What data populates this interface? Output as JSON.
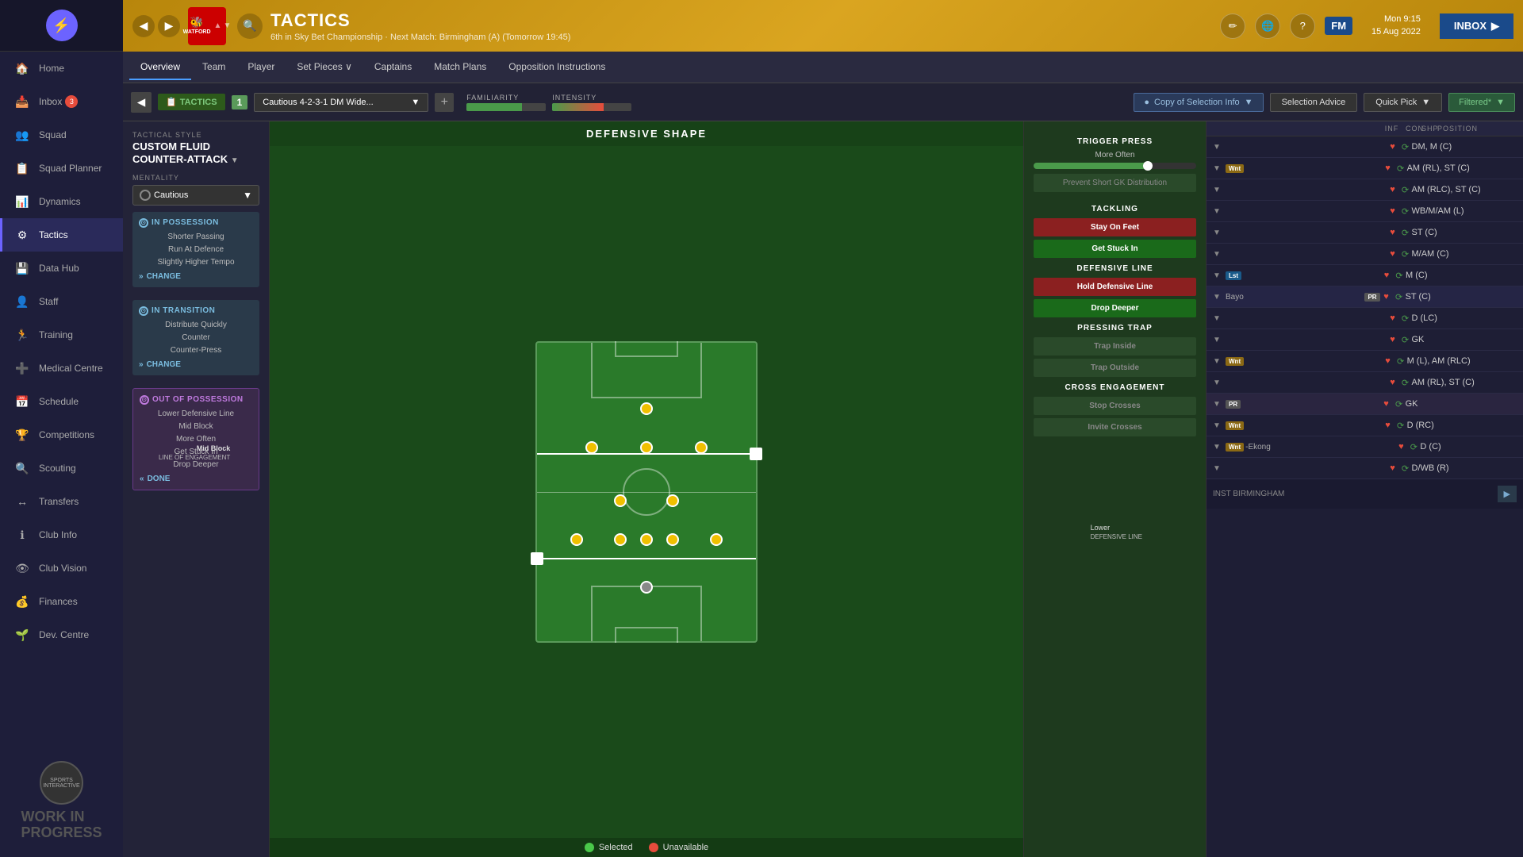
{
  "sidebar": {
    "items": [
      {
        "label": "Home",
        "icon": "🏠",
        "active": false,
        "badge": null
      },
      {
        "label": "Inbox",
        "icon": "📥",
        "active": false,
        "badge": "3"
      },
      {
        "label": "Squad",
        "icon": "👥",
        "active": false,
        "badge": null
      },
      {
        "label": "Squad Planner",
        "icon": "📋",
        "active": false,
        "badge": null
      },
      {
        "label": "Dynamics",
        "icon": "📊",
        "active": false,
        "badge": null
      },
      {
        "label": "Tactics",
        "icon": "⚙",
        "active": true,
        "badge": null
      },
      {
        "label": "Data Hub",
        "icon": "💾",
        "active": false,
        "badge": null
      },
      {
        "label": "Staff",
        "icon": "👤",
        "active": false,
        "badge": null
      },
      {
        "label": "Training",
        "icon": "🏃",
        "active": false,
        "badge": null
      },
      {
        "label": "Medical Centre",
        "icon": "➕",
        "active": false,
        "badge": null
      },
      {
        "label": "Schedule",
        "icon": "📅",
        "active": false,
        "badge": null
      },
      {
        "label": "Competitions",
        "icon": "🏆",
        "active": false,
        "badge": null
      },
      {
        "label": "Scouting",
        "icon": "🔍",
        "active": false,
        "badge": null
      },
      {
        "label": "Transfers",
        "icon": "↔",
        "active": false,
        "badge": null
      },
      {
        "label": "Club Info",
        "icon": "ℹ",
        "active": false,
        "badge": null
      },
      {
        "label": "Club Vision",
        "icon": "👁",
        "active": false,
        "badge": null
      },
      {
        "label": "Finances",
        "icon": "💰",
        "active": false,
        "badge": null
      },
      {
        "label": "Dev. Centre",
        "icon": "🌱",
        "active": false,
        "badge": null
      }
    ],
    "wip_text": "WORK IN\nPROGRESS"
  },
  "topbar": {
    "title": "TACTICS",
    "subtitle": "6th in Sky Bet Championship · Next Match: Birmingham (A) (Tomorrow 19:45)",
    "datetime": "Mon 9:15\n15 Aug 2022",
    "inbox_label": "INBOX"
  },
  "subnav": {
    "items": [
      "Overview",
      "Team",
      "Player",
      "Set Pieces ∨",
      "Captains",
      "Match Plans",
      "Opposition Instructions"
    ],
    "active": "Overview"
  },
  "tactics_bar": {
    "label": "TACTICS",
    "number": "1",
    "formation": "Cautious 4-2-3-1 DM Wide...",
    "familiarity_label": "FAMILIARITY",
    "intensity_label": "INTENSITY",
    "familiarity_pct": 70,
    "intensity_pct": 65,
    "copy_label": "Copy of Selection Info",
    "selection_advice_label": "Selection Advice",
    "quick_pick_label": "Quick Pick",
    "filtered_label": "Filtered*"
  },
  "left_panel": {
    "tactical_style_label": "TACTICAL STYLE",
    "tactical_style_name": "CUSTOM FLUID\nCOUNTER-ATTACK",
    "mentality_label": "MENTALITY",
    "mentality_value": "Cautious",
    "in_possession_title": "IN POSSESSION",
    "in_possession_items": [
      "Shorter Passing",
      "Run At Defence",
      "Slightly Higher Tempo"
    ],
    "change_label": "CHANGE",
    "in_transition_title": "IN TRANSITION",
    "in_transition_items": [
      "Distribute Quickly",
      "Counter",
      "Counter-Press"
    ],
    "change2_label": "CHANGE",
    "out_of_possession_title": "OUT OF POSSESSION",
    "out_of_possession_items": [
      "Lower Defensive Line",
      "Mid Block",
      "More Often",
      "Get Stuck In",
      "Drop Deeper"
    ],
    "done_label": "DONE"
  },
  "pitch": {
    "title": "DEFENSIVE SHAPE",
    "engagement_label": "Mid Block\nLINE OF ENGAGEMENT",
    "defensive_label": "Lower\nDEFENSIVE LINE",
    "legend_selected": "Selected",
    "legend_unavailable": "Unavailable"
  },
  "right_tactics": {
    "trigger_press_title": "TRIGGER PRESS",
    "trigger_press_value": "More Often",
    "prevent_label": "Prevent Short GK Distribution",
    "tackling_title": "TACKLING",
    "stay_on_feet_label": "Stay On Feet",
    "get_stuck_in_label": "Get Stuck In",
    "defensive_line_title": "DEFENSIVE LINE",
    "hold_defensive_label": "Hold Defensive Line",
    "drop_deeper_label": "Drop Deeper",
    "pressing_trap_title": "PRESSING TRAP",
    "trap_inside_label": "Trap Inside",
    "trap_outside_label": "Trap Outside",
    "cross_engagement_title": "CROSS ENGAGEMENT",
    "stop_crosses_label": "Stop Crosses",
    "invite_crosses_label": "Invite Crosses"
  },
  "player_list": {
    "columns": [
      "INF",
      "CON",
      "SHP",
      "POSITION"
    ],
    "players": [
      {
        "badge": null,
        "heart": true,
        "refresh": true,
        "position": "DM, M (C)",
        "name": ""
      },
      {
        "badge": "Wnt",
        "heart": true,
        "refresh": true,
        "position": "AM (RL), ST (C)",
        "name": ""
      },
      {
        "badge": null,
        "heart": true,
        "refresh": true,
        "position": "AM (RLC), ST (C)",
        "name": ""
      },
      {
        "badge": null,
        "heart": true,
        "refresh": true,
        "position": "WB/M/AM (L)",
        "name": ""
      },
      {
        "badge": null,
        "heart": true,
        "refresh": true,
        "position": "ST (C)",
        "name": ""
      },
      {
        "badge": null,
        "heart": true,
        "refresh": true,
        "position": "M/AM (C)",
        "name": ""
      },
      {
        "badge": "Lst",
        "heart": true,
        "refresh": true,
        "position": "M (C)",
        "name": ""
      },
      {
        "badge": null,
        "heart": true,
        "refresh": true,
        "position": "ST (C)",
        "name": "Bayo"
      },
      {
        "badge": null,
        "heart": true,
        "refresh": true,
        "position": "D (LC)",
        "name": ""
      },
      {
        "badge": null,
        "heart": true,
        "refresh": true,
        "position": "GK",
        "name": ""
      },
      {
        "badge": "Wnt",
        "heart": true,
        "refresh": true,
        "position": "M (L), AM (RLC)",
        "name": ""
      },
      {
        "badge": null,
        "heart": true,
        "refresh": true,
        "position": "AM (RL), ST (C)",
        "name": ""
      },
      {
        "badge": "PR",
        "heart": true,
        "refresh": true,
        "position": "GK",
        "name": ""
      },
      {
        "badge": "Wnt",
        "heart": true,
        "refresh": true,
        "position": "D (RC)",
        "name": ""
      },
      {
        "badge": "Wnt",
        "heart": true,
        "refresh": true,
        "position": "D (C)",
        "name": "-Ekong"
      },
      {
        "badge": null,
        "heart": true,
        "refresh": true,
        "position": "D/WB (R)",
        "name": ""
      }
    ],
    "against_label": "INST BIRMINGHAM"
  }
}
